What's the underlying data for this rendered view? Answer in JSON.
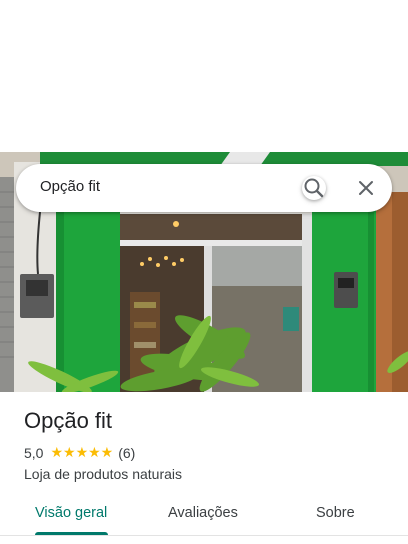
{
  "search": {
    "query": "Opção fit"
  },
  "place": {
    "name": "Opção fit",
    "rating": "5,0",
    "stars": "★★★★★",
    "review_count": "(6)",
    "category": "Loja de produtos naturais"
  },
  "tabs": [
    {
      "label": "Visão geral",
      "active": true
    },
    {
      "label": "Avaliações",
      "active": false
    },
    {
      "label": "Sobre",
      "active": false
    }
  ],
  "colors": {
    "accent": "#00796b",
    "star": "#fbbc04",
    "storefront_green": "#1ea53c"
  },
  "icons": {
    "search": "search-icon",
    "close": "close-icon"
  }
}
